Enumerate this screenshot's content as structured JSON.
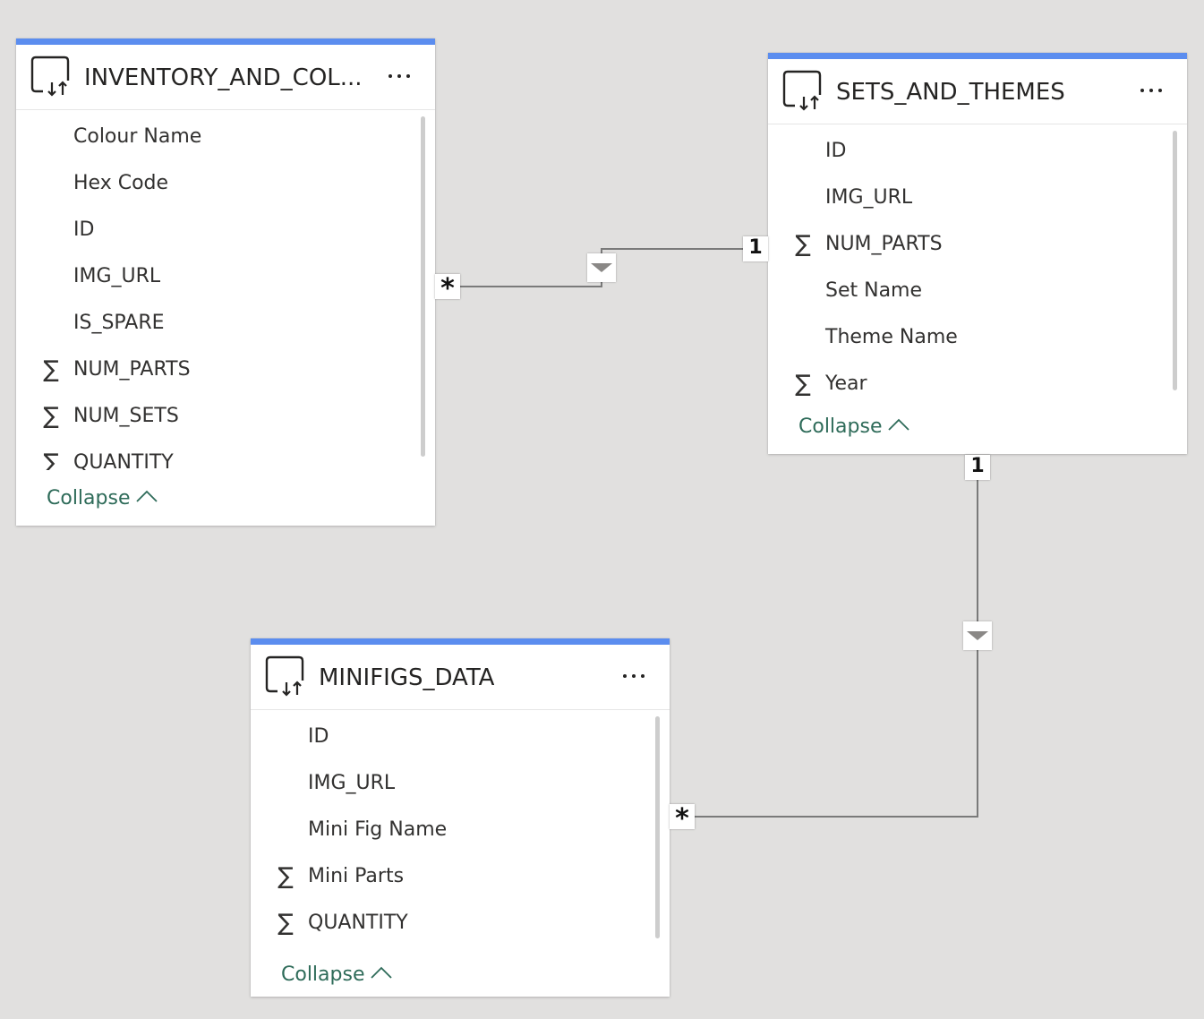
{
  "tables": [
    {
      "title": "INVENTORY_AND_COL...",
      "fields": [
        {
          "name": "Colour Name",
          "sum": false
        },
        {
          "name": "Hex Code",
          "sum": false
        },
        {
          "name": "ID",
          "sum": false
        },
        {
          "name": "IMG_URL",
          "sum": false
        },
        {
          "name": "IS_SPARE",
          "sum": false
        },
        {
          "name": "NUM_PARTS",
          "sum": true
        },
        {
          "name": "NUM_SETS",
          "sum": true
        },
        {
          "name": "QUANTITY",
          "sum": true
        }
      ],
      "collapse_label": "Collapse"
    },
    {
      "title": "SETS_AND_THEMES",
      "fields": [
        {
          "name": "ID",
          "sum": false
        },
        {
          "name": "IMG_URL",
          "sum": false
        },
        {
          "name": "NUM_PARTS",
          "sum": true
        },
        {
          "name": "Set Name",
          "sum": false
        },
        {
          "name": "Theme Name",
          "sum": false
        },
        {
          "name": "Year",
          "sum": true
        }
      ],
      "collapse_label": "Collapse"
    },
    {
      "title": "MINIFIGS_DATA",
      "fields": [
        {
          "name": "ID",
          "sum": false
        },
        {
          "name": "IMG_URL",
          "sum": false
        },
        {
          "name": "Mini Fig Name",
          "sum": false
        },
        {
          "name": "Mini Parts",
          "sum": true
        },
        {
          "name": "QUANTITY",
          "sum": true
        }
      ],
      "collapse_label": "Collapse"
    }
  ],
  "sigma_symbol": "∑",
  "relationships": [
    {
      "from_label": "*",
      "to_label": "1"
    },
    {
      "from_label": "*",
      "to_label": "1"
    }
  ],
  "colors": {
    "accent": "#5b8def",
    "collapse": "#2e6b59",
    "canvas": "#e1e0df",
    "line": "#7a7a7a"
  }
}
